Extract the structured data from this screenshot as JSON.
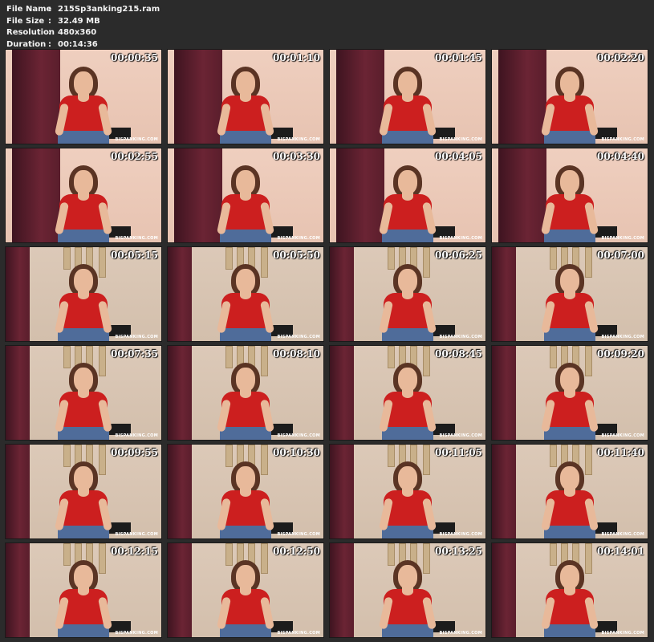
{
  "info": {
    "file_name_label": "File Name",
    "file_name_value": "215Sp3anking215.ram",
    "file_size_label": "File Size",
    "file_size_value": "32.49 MB",
    "resolution_label": "Resolution",
    "resolution_value": "480x360",
    "duration_label": "Duration",
    "duration_value": "00:14:36",
    "separator": ":"
  },
  "watermark": "BISPANKING.COM",
  "thumbnails": [
    {
      "time": "00:00:35",
      "scene": "warm"
    },
    {
      "time": "00:01:10",
      "scene": "warm"
    },
    {
      "time": "00:01:45",
      "scene": "warm"
    },
    {
      "time": "00:02:20",
      "scene": "warm"
    },
    {
      "time": "00:02:55",
      "scene": "warm"
    },
    {
      "time": "00:03:30",
      "scene": "warm"
    },
    {
      "time": "00:04:05",
      "scene": "warm"
    },
    {
      "time": "00:04:40",
      "scene": "warm"
    },
    {
      "time": "00:05:15",
      "scene": "beige"
    },
    {
      "time": "00:05:50",
      "scene": "beige"
    },
    {
      "time": "00:06:25",
      "scene": "beige"
    },
    {
      "time": "00:07:00",
      "scene": "beige"
    },
    {
      "time": "00:07:35",
      "scene": "beige"
    },
    {
      "time": "00:08:10",
      "scene": "beige"
    },
    {
      "time": "00:08:45",
      "scene": "beige"
    },
    {
      "time": "00:09:20",
      "scene": "beige"
    },
    {
      "time": "00:09:55",
      "scene": "beige"
    },
    {
      "time": "00:10:30",
      "scene": "beige"
    },
    {
      "time": "00:11:05",
      "scene": "beige"
    },
    {
      "time": "00:11:40",
      "scene": "beige"
    },
    {
      "time": "00:12:15",
      "scene": "beige"
    },
    {
      "time": "00:12:50",
      "scene": "beige"
    },
    {
      "time": "00:13:25",
      "scene": "beige"
    },
    {
      "time": "00:14:01",
      "scene": "beige"
    }
  ]
}
